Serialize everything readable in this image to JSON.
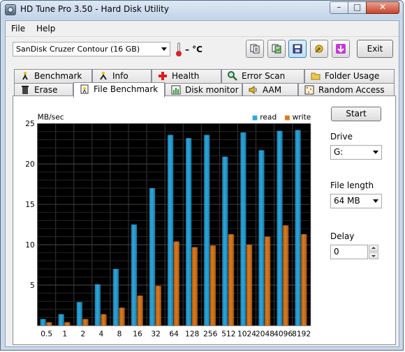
{
  "window": {
    "title": "HD Tune Pro 3.50 - Hard Disk Utility",
    "minimize": "–",
    "maximize": "□",
    "close": "✕"
  },
  "menu": {
    "file": "File",
    "help": "Help"
  },
  "toolbar": {
    "drive": "SanDisk Cruzer Contour (16 GB)",
    "temperature": "– °C",
    "exit_label": "Exit",
    "icons": [
      "copy-text-icon",
      "copy-image-icon",
      "save-icon",
      "options-icon",
      "down-arrow-icon"
    ]
  },
  "tabs": {
    "row1": [
      {
        "label": "Benchmark",
        "icon": "benchmark-icon"
      },
      {
        "label": "Info",
        "icon": "info-icon"
      },
      {
        "label": "Health",
        "icon": "health-icon"
      },
      {
        "label": "Error Scan",
        "icon": "error-scan-icon"
      },
      {
        "label": "Folder Usage",
        "icon": "folder-icon"
      }
    ],
    "row2": [
      {
        "label": "Erase",
        "icon": "trash-icon"
      },
      {
        "label": "File Benchmark",
        "icon": "file-benchmark-icon",
        "selected": true
      },
      {
        "label": "Disk monitor",
        "icon": "disk-monitor-icon"
      },
      {
        "label": "AAM",
        "icon": "speaker-icon"
      },
      {
        "label": "Random Access",
        "icon": "random-access-icon"
      }
    ]
  },
  "controls": {
    "start_label": "Start",
    "drive_label": "Drive",
    "drive_value": "G:",
    "file_length_label": "File length",
    "file_length_value": "64 MB",
    "delay_label": "Delay",
    "delay_value": "0"
  },
  "chart_data": {
    "type": "bar",
    "ylabel": "MB/sec",
    "ylim": [
      0,
      25
    ],
    "yticks": [
      5,
      10,
      15,
      20,
      25
    ],
    "grid": true,
    "legend_position": "top-right",
    "categories": [
      "0.5",
      "1",
      "2",
      "4",
      "8",
      "16",
      "32",
      "64",
      "128",
      "256",
      "512",
      "1024",
      "2048",
      "4096",
      "8192"
    ],
    "series": [
      {
        "name": "read",
        "color": "#2aa8e0",
        "values": [
          0.8,
          1.4,
          2.9,
          5.1,
          7.0,
          12.5,
          17.0,
          23.6,
          23.2,
          23.6,
          20.9,
          23.9,
          21.7,
          24.1,
          24.2
        ]
      },
      {
        "name": "write",
        "color": "#e07a1c",
        "values": [
          0.4,
          0.4,
          0.8,
          1.4,
          2.2,
          3.7,
          4.9,
          10.4,
          9.7,
          9.9,
          11.3,
          10.0,
          11.0,
          12.4,
          11.3
        ]
      }
    ]
  }
}
